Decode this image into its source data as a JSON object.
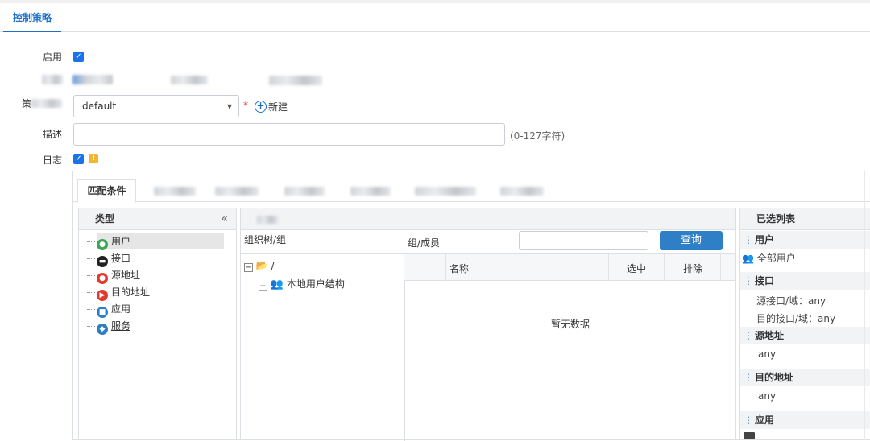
{
  "header": {
    "active_tab": "控制策略"
  },
  "form": {
    "enable_label": "启用",
    "enable_checked": true,
    "policy_group_label": "策",
    "policy_group_value": "default",
    "new_button": "新建",
    "desc_label": "描述",
    "desc_value": "",
    "desc_hint": "(0-127字符)",
    "log_label": "日志",
    "log_checked": true
  },
  "tabs": {
    "active": "匹配条件"
  },
  "type_panel": {
    "title": "类型",
    "collapse_icon": "«",
    "items": [
      {
        "label": "用户",
        "icon": "user-icon",
        "color": "#3aa655"
      },
      {
        "label": "接口",
        "icon": "interface-icon",
        "color": "#222222"
      },
      {
        "label": "源地址",
        "icon": "source-address-icon",
        "color": "#e23b2e"
      },
      {
        "label": "目的地址",
        "icon": "destination-address-icon",
        "color": "#e23b2e"
      },
      {
        "label": "应用",
        "icon": "application-icon",
        "color": "#2f7fc6"
      },
      {
        "label": "服务",
        "icon": "service-icon",
        "color": "#2f7fc6"
      }
    ]
  },
  "org_panel": {
    "tree_header": "组织树/组",
    "root": "/",
    "child": "本地用户结构",
    "member_header": "组/成员",
    "search_value": "",
    "query_button": "查询",
    "columns": [
      "名称",
      "选中",
      "排除"
    ],
    "empty_text": "暂无数据"
  },
  "selected_panel": {
    "title": "已选列表",
    "sections": [
      {
        "name": "用户",
        "items": [
          "全部用户"
        ]
      },
      {
        "name": "接口",
        "items": [
          "源接口/域：any",
          "目的接口/域：any"
        ]
      },
      {
        "name": "源地址",
        "items": [
          "any"
        ]
      },
      {
        "name": "目的地址",
        "items": [
          "any"
        ]
      },
      {
        "name": "应用",
        "items": []
      }
    ]
  }
}
